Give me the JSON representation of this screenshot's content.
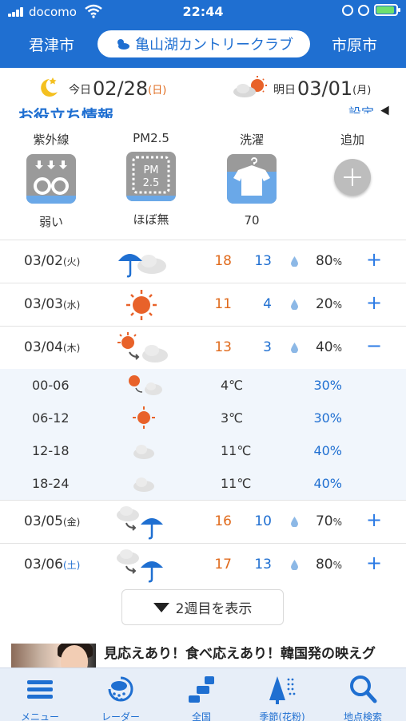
{
  "status_bar": {
    "carrier": "docomo",
    "time": "22:44"
  },
  "header": {
    "left_city": "君津市",
    "location": "亀山湖カントリークラブ",
    "right_city": "市原市"
  },
  "dates": {
    "today_label": "今日",
    "today_date": "02/28",
    "today_dow": "(日)",
    "tomorrow_label": "明日",
    "tomorrow_date": "03/01",
    "tomorrow_dow": "(月)"
  },
  "info": {
    "heading": "お役立ち情報",
    "settings": "設定",
    "items": [
      {
        "title": "紫外線",
        "value": "弱い",
        "icon": "uv-icon"
      },
      {
        "title": "PM2.5",
        "value": "ほぼ無",
        "icon": "pm25-icon"
      },
      {
        "title": "洗濯",
        "value": "70",
        "icon": "laundry-icon"
      },
      {
        "title": "追加",
        "value": "",
        "icon": "add-icon"
      }
    ]
  },
  "days": [
    {
      "date": "03/02",
      "dow": "(火)",
      "dow_color": "normal",
      "icon": "umbrella-cloud-icon",
      "high": "18",
      "low": "13",
      "pop": "80",
      "pop_unit": "%",
      "toggle": "+"
    },
    {
      "date": "03/03",
      "dow": "(水)",
      "dow_color": "normal",
      "icon": "sun-icon",
      "high": "11",
      "low": "4",
      "pop": "20",
      "pop_unit": "%",
      "toggle": "+"
    },
    {
      "date": "03/04",
      "dow": "(木)",
      "dow_color": "normal",
      "icon": "sun-to-cloud-icon",
      "high": "13",
      "low": "3",
      "pop": "40",
      "pop_unit": "%",
      "toggle": "−"
    },
    {
      "date": "03/05",
      "dow": "(金)",
      "dow_color": "normal",
      "icon": "cloud-to-rain-icon",
      "high": "16",
      "low": "10",
      "pop": "70",
      "pop_unit": "%",
      "toggle": "+"
    },
    {
      "date": "03/06",
      "dow": "(土)",
      "dow_color": "blue",
      "icon": "cloud-to-rain-icon",
      "high": "17",
      "low": "13",
      "pop": "80",
      "pop_unit": "%",
      "toggle": "+"
    }
  ],
  "detail": [
    {
      "time": "00-06",
      "icon": "sun-to-cloud-icon",
      "temp": "4℃",
      "pop": "30%"
    },
    {
      "time": "06-12",
      "icon": "sun-icon",
      "temp": "3℃",
      "pop": "30%"
    },
    {
      "time": "12-18",
      "icon": "cloud-icon",
      "temp": "11℃",
      "pop": "40%"
    },
    {
      "time": "18-24",
      "icon": "cloud-icon",
      "temp": "11℃",
      "pop": "40%"
    }
  ],
  "week2_button": "2週目を表示",
  "ad": {
    "text": "見応えあり！食べ応えあり！韓国発の映えグ"
  },
  "tabs": [
    {
      "label": "メニュー",
      "icon": "menu-icon"
    },
    {
      "label": "レーダー",
      "icon": "radar-icon"
    },
    {
      "label": "全国",
      "icon": "japan-map-icon"
    },
    {
      "label": "季節(花粉)",
      "icon": "pollen-tree-icon"
    },
    {
      "label": "地点検索",
      "icon": "search-icon"
    }
  ],
  "colors": {
    "brand_blue": "#1f6fd1",
    "high_temp": "#e06a1c",
    "low_temp": "#1f6fd1"
  }
}
